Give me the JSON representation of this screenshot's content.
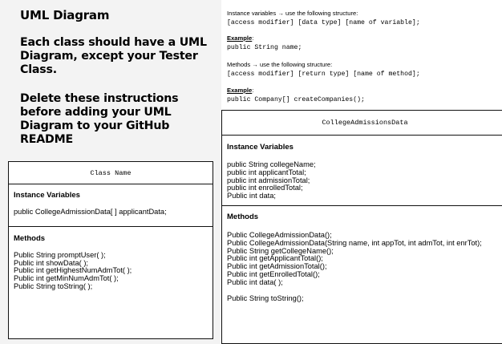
{
  "left": {
    "title": "UML Diagram",
    "note1": "Each class should have a UML Diagram, except your Tester Class.",
    "note2": "Delete these instructions before adding your UML Diagram to your GitHub README"
  },
  "template_box": {
    "class_name": "Class Name",
    "instance_title": "Instance Variables",
    "instance_vars": [
      "public CollegeAdmissionData[ ] applicantData;"
    ],
    "methods_title": "Methods",
    "methods": [
      "Public String promptUser( );",
      "Public int showData( );",
      "Public int getHighestNumAdmTot( );",
      "Public int getMinNumAdmTot( );",
      "Public String toString( );"
    ]
  },
  "instructions": {
    "line1": "Instance variables → use the following structure:",
    "line2": "[access modifier] [data type] [name of variable];",
    "example1_label": "Example",
    "example1": "public String name;",
    "line3": "Methods → use the following structure:",
    "line4": "[access modifier] [return type] [name of method];",
    "example2_label": "Example",
    "example2": "public Company[] createCompanies();"
  },
  "college_box": {
    "class_name": "CollegeAdmissionsData",
    "instance_title": "Instance Variables",
    "instance_vars": [
      "public String collegeName;",
      "public int applicantTotal;",
      "public int admissionTotal;",
      "public int enrolledTotal;",
      "Public int data;"
    ],
    "methods_title": "Methods",
    "methods": [
      "Public CollegeAdmissionData();",
      "Public CollegeAdmissionData(String name, int appTot, int admTot, int enrTot);",
      "Public String getCollegeName();",
      "Public int getApplicantTotal();",
      "Public int getAdmissionTotal();",
      "Public int getEnrolledTotal();",
      "Public int data( );"
    ],
    "method_last": "Public String toString();"
  }
}
